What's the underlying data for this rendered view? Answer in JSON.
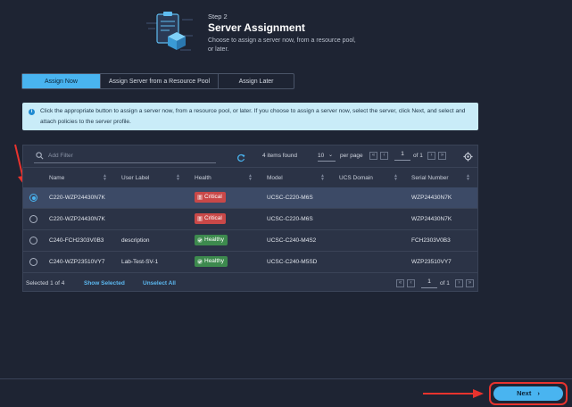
{
  "header": {
    "step": "Step 2",
    "title": "Server Assignment",
    "description": "Choose to assign a server now, from a resource pool, or later."
  },
  "tabs": [
    {
      "label": "Assign Now",
      "active": true
    },
    {
      "label": "Assign Server from a Resource Pool",
      "active": false
    },
    {
      "label": "Assign Later",
      "active": false
    }
  ],
  "banner": {
    "text": "Click the appropriate button to assign a server now, from a resource pool, or later. If you choose to assign a server now, select the server, click Next, and select and attach policies to the server profile."
  },
  "toolbar": {
    "filter_placeholder": "Add Filter",
    "items_found": "4 items found",
    "per_page_value": "10",
    "per_page_label": "per page",
    "page_current": "1",
    "page_of": "of 1"
  },
  "table": {
    "columns": [
      "Name",
      "User Label",
      "Health",
      "Model",
      "UCS Domain",
      "Serial Number"
    ],
    "rows": [
      {
        "selected": true,
        "name": "C220-WZP24430N7K",
        "user_label": "",
        "health": "Critical",
        "model": "UCSC-C220-M6S",
        "ucs_domain": "",
        "serial": "WZP24430N7K"
      },
      {
        "selected": false,
        "name": "C220-WZP24430N7K",
        "user_label": "",
        "health": "Critical",
        "model": "UCSC-C220-M6S",
        "ucs_domain": "",
        "serial": "WZP24430N7K"
      },
      {
        "selected": false,
        "name": "C240-FCH2303V0B3",
        "user_label": "description",
        "health": "Healthy",
        "model": "UCSC-C240-M4S2",
        "ucs_domain": "",
        "serial": "FCH2303V0B3"
      },
      {
        "selected": false,
        "name": "C240-WZP23510VY7",
        "user_label": "Lab-Test-SV-1",
        "health": "Healthy",
        "model": "UCSC-C240-M5SD",
        "ucs_domain": "",
        "serial": "WZP23510VY7"
      }
    ]
  },
  "footer": {
    "selected_text": "Selected 1 of 4",
    "show_selected": "Show Selected",
    "unselect_all": "Unselect All",
    "page_current": "1",
    "page_of": "of 1"
  },
  "actions": {
    "next_label": "Next"
  },
  "colors": {
    "accent": "#49b4f0",
    "critical": "#c94848",
    "healthy": "#3d8a4e",
    "annotation_red": "#e8332e"
  }
}
